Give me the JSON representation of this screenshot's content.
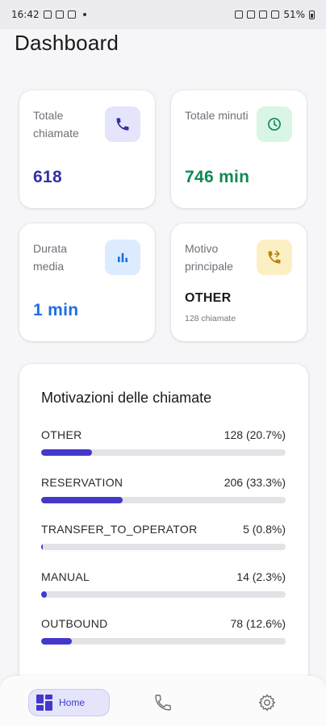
{
  "status_bar": {
    "time": "16:42",
    "battery": "51%"
  },
  "header": {
    "title": "Dashboard"
  },
  "stats": {
    "total_calls": {
      "label": "Totale chiamate",
      "value": "618",
      "icon": "phone-icon",
      "color": "#3730a3"
    },
    "total_minutes": {
      "label": "Totale minuti",
      "value": "746 min",
      "icon": "clock-icon",
      "color": "#0f8a55"
    },
    "avg_duration": {
      "label": "Durata media",
      "value": "1 min",
      "icon": "bar-chart-icon",
      "color": "#1d6fe0"
    },
    "main_reason": {
      "label": "Motivo principale",
      "value": "OTHER",
      "sub": "128 chiamate",
      "icon": "phone-forward-icon",
      "color": "#1a1a1a"
    }
  },
  "reasons": {
    "title": "Motivazioni delle chiamate",
    "items": [
      {
        "name": "OTHER",
        "count": "128 (20.7%)",
        "percent": 20.7
      },
      {
        "name": "RESERVATION",
        "count": "206 (33.3%)",
        "percent": 33.3
      },
      {
        "name": "TRANSFER_TO_OPERATOR",
        "count": "5 (0.8%)",
        "percent": 0.8
      },
      {
        "name": "MANUAL",
        "count": "14 (2.3%)",
        "percent": 2.3
      },
      {
        "name": "OUTBOUND",
        "count": "78 (12.6%)",
        "percent": 12.6
      }
    ],
    "bar_color": "#4338ca"
  },
  "nav": {
    "home_label": "Home"
  }
}
